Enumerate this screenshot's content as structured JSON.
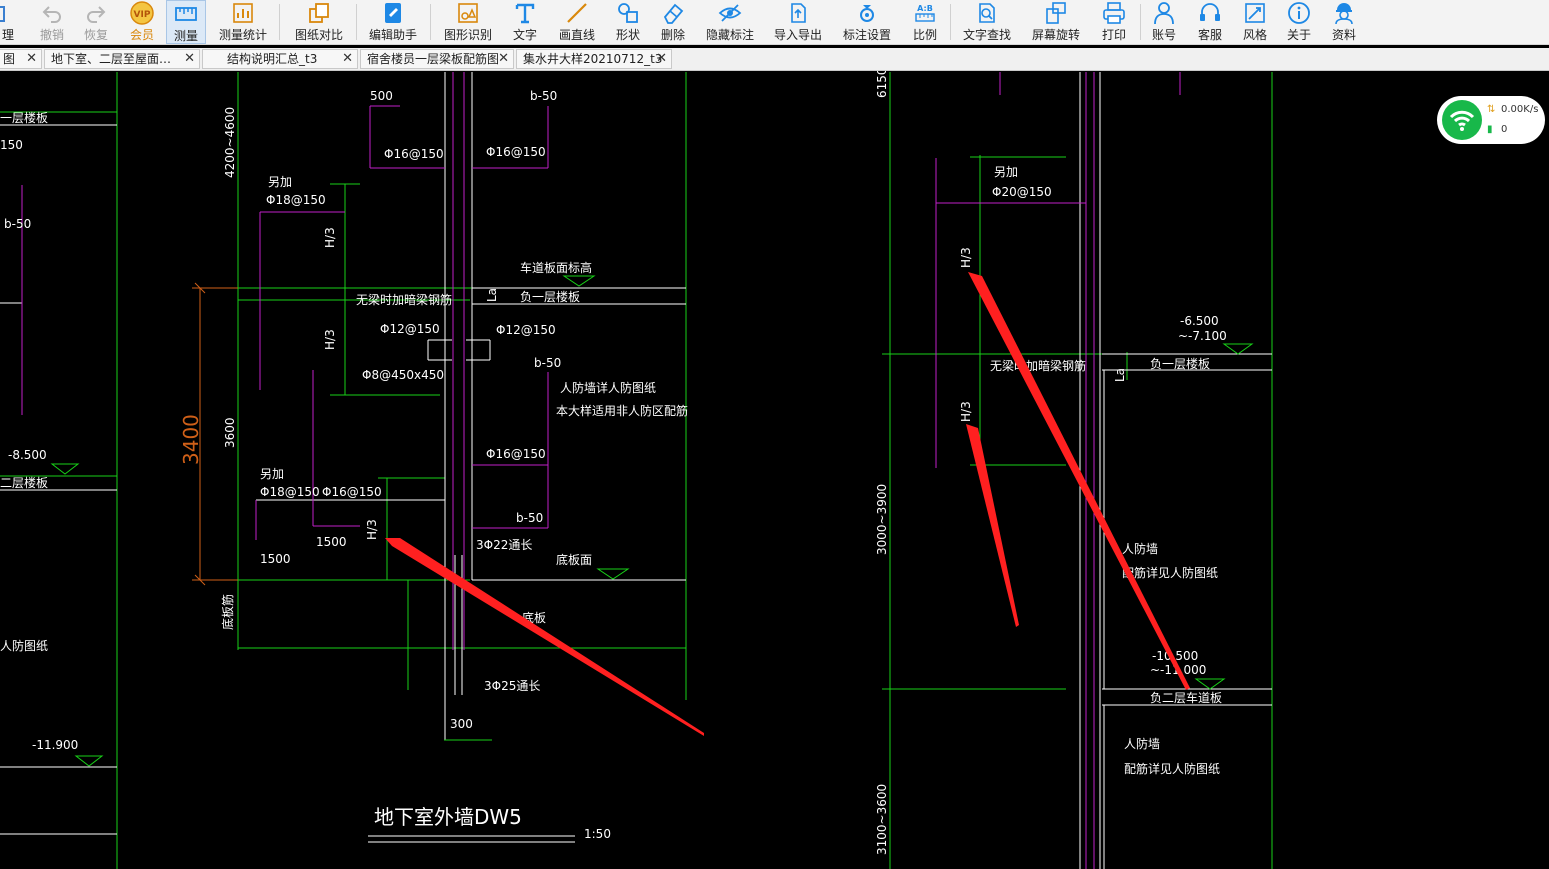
{
  "toolbar": {
    "items": [
      {
        "label": "理",
        "icon": "partial-icon",
        "state": "normal"
      },
      {
        "label": "撤销",
        "icon": "undo-icon",
        "state": "disabled"
      },
      {
        "label": "恢复",
        "icon": "redo-icon",
        "state": "disabled"
      },
      {
        "label": "会员",
        "icon": "vip-icon",
        "state": "vip"
      },
      {
        "label": "测量",
        "icon": "measure-icon",
        "state": "active"
      },
      {
        "label": "测量统计",
        "icon": "measure-stats-icon",
        "state": "normal"
      },
      {
        "label": "图纸对比",
        "icon": "compare-icon",
        "state": "normal"
      },
      {
        "label": "编辑助手",
        "icon": "edit-assistant-icon",
        "state": "normal"
      },
      {
        "label": "图形识别",
        "icon": "shape-recognition-icon",
        "state": "normal"
      },
      {
        "label": "文字",
        "icon": "text-icon",
        "state": "normal"
      },
      {
        "label": "画直线",
        "icon": "line-icon",
        "state": "normal"
      },
      {
        "label": "形状",
        "icon": "shape-icon",
        "state": "normal"
      },
      {
        "label": "删除",
        "icon": "eraser-icon",
        "state": "normal"
      },
      {
        "label": "隐藏标注",
        "icon": "hide-annotation-icon",
        "state": "normal"
      },
      {
        "label": "导入导出",
        "icon": "import-export-icon",
        "state": "normal"
      },
      {
        "label": "标注设置",
        "icon": "annotation-settings-icon",
        "state": "normal"
      },
      {
        "label": "比例",
        "icon": "scale-icon",
        "state": "normal"
      },
      {
        "label": "文字查找",
        "icon": "text-search-icon",
        "state": "normal"
      },
      {
        "label": "屏幕旋转",
        "icon": "rotate-screen-icon",
        "state": "normal"
      },
      {
        "label": "打印",
        "icon": "print-icon",
        "state": "normal"
      },
      {
        "label": "账号",
        "icon": "account-icon",
        "state": "normal"
      },
      {
        "label": "客服",
        "icon": "headset-icon",
        "state": "normal"
      },
      {
        "label": "风格",
        "icon": "style-icon",
        "state": "normal"
      },
      {
        "label": "关于",
        "icon": "info-icon",
        "state": "normal"
      },
      {
        "label": "资料",
        "icon": "worker-icon",
        "state": "normal"
      }
    ]
  },
  "tabs": [
    {
      "label": "图"
    },
    {
      "label": "地下室、二层至屋面…"
    },
    {
      "label": "结构说明汇总_t3"
    },
    {
      "label": "宿舍楼员一层梁板配筋图"
    },
    {
      "label": "集水井大样20210712_t3"
    }
  ],
  "network_widget": {
    "speed": "0.00K/s",
    "count": "0",
    "accent": "#18b84a"
  },
  "drawing": {
    "title": "地下室外墙DW5",
    "scale": "1:50",
    "dimension_3400": "3400",
    "labels": {
      "b50": "b-50",
      "dim500": "500",
      "dim4200_4600": "4200~4600",
      "dim3600": "3600",
      "dim1500": "1500",
      "dim300": "300",
      "phi16_150": "Φ16@150",
      "phi18_150": "Φ18@150",
      "phi12_150": "Φ12@150",
      "phi8_450": "Φ8@450x450",
      "phi20_150": "Φ20@150",
      "bar3phi22": "3Φ22通长",
      "bar3phi25": "3Φ25通长",
      "h3": "H/3",
      "la": "La",
      "extra": "另加",
      "no_beam": "无梁时加暗梁钢筋",
      "floor_b1": "负一层楼板",
      "floor_b2": "负二层楼板",
      "floor_b2_roof": "负二层车道板",
      "floor_b2_top": "负一层楼板",
      "ramp_top": "车道板面标高",
      "bottom_face": "底板面",
      "bottom_slab": "底板",
      "slab_rebar": "底板筋",
      "civil_def_1": "人防墙详人防图纸",
      "civil_def_2": "本大样适用非人防区配筋",
      "civil_def_wall": "人防墙",
      "civil_def_wall_note": "配筋详见人防图纸",
      "neg8500": "-8.500",
      "neg11900": "-11.900",
      "neg6500": "-6.500",
      "neg7100": "~-7.100",
      "neg10500": "-10.500",
      "neg11000": "~-11.000",
      "dim6150": "6150~",
      "dim3000_3900": "3000~3900",
      "dim3100_3600": "3100~3600",
      "left_150": "150",
      "left_civil": "人防图纸",
      "left_b2": "二层楼板",
      "left_b1": "一层楼板"
    }
  },
  "colors": {
    "green": "#18d018",
    "magenta": "#c020c8",
    "white": "#ffffff",
    "orange": "#d06018",
    "red": "#ff2020",
    "accent": "#1e88e5"
  }
}
